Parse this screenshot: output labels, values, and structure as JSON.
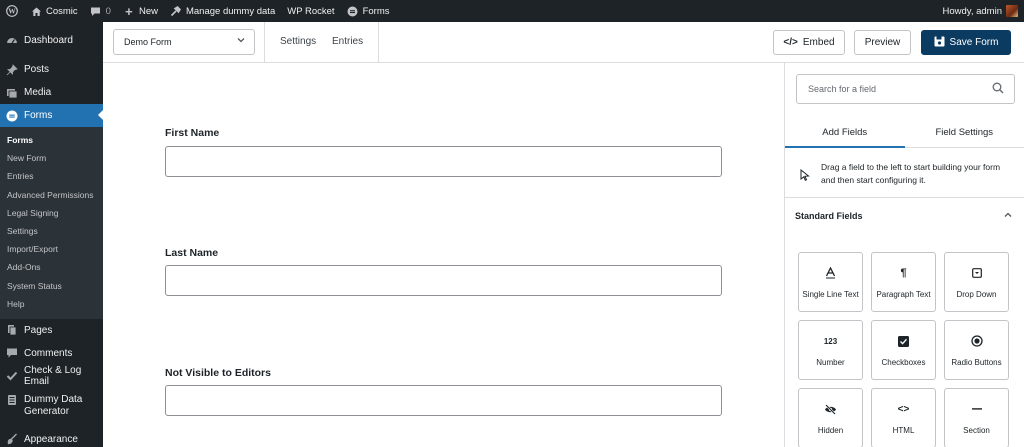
{
  "adminbar": {
    "site_name": "Cosmic",
    "comments_count": "0",
    "new_label": "New",
    "manage_label": "Manage dummy data",
    "rocket_label": "WP Rocket",
    "forms_label": "Forms",
    "greeting": "Howdy, admin"
  },
  "sidebar": {
    "dashboard": "Dashboard",
    "posts": "Posts",
    "media": "Media",
    "forms": "Forms",
    "submenu": [
      "Forms",
      "New Form",
      "Entries",
      "Advanced Permissions",
      "Legal Signing",
      "Settings",
      "Import/Export",
      "Add-Ons",
      "System Status",
      "Help"
    ],
    "pages": "Pages",
    "comments": "Comments",
    "check_log": "Check & Log Email",
    "dummy_line1": "Dummy Data",
    "dummy_line2": "Generator",
    "appearance": "Appearance"
  },
  "toolbar": {
    "form_select_value": "Demo Form",
    "settings_link": "Settings",
    "entries_link": "Entries",
    "embed_label": "Embed",
    "preview_label": "Preview",
    "save_label": "Save Form",
    "accent": "#0c3b61"
  },
  "form": {
    "fields": [
      {
        "label": "First Name"
      },
      {
        "label": "Last Name"
      },
      {
        "label": "Not Visible to Editors"
      }
    ]
  },
  "panel": {
    "search_placeholder": "Search for a field",
    "tab_add": "Add Fields",
    "tab_settings": "Field Settings",
    "hint": "Drag a field to the left to start building your form and then start configuring it.",
    "section_title": "Standard Fields",
    "tiles": [
      {
        "label": "Single Line Text",
        "icon": "text-a-icon"
      },
      {
        "label": "Paragraph Text",
        "icon": "pilcrow-icon"
      },
      {
        "label": "Drop Down",
        "icon": "dropdown-icon"
      },
      {
        "label": "Number",
        "icon": "number-icon",
        "glyph": "123"
      },
      {
        "label": "Checkboxes",
        "icon": "checkbox-icon"
      },
      {
        "label": "Radio Buttons",
        "icon": "radio-icon"
      },
      {
        "label": "Hidden",
        "icon": "eye-slash-icon"
      },
      {
        "label": "HTML",
        "icon": "code-icon"
      },
      {
        "label": "Section",
        "icon": "dash-icon"
      }
    ]
  }
}
